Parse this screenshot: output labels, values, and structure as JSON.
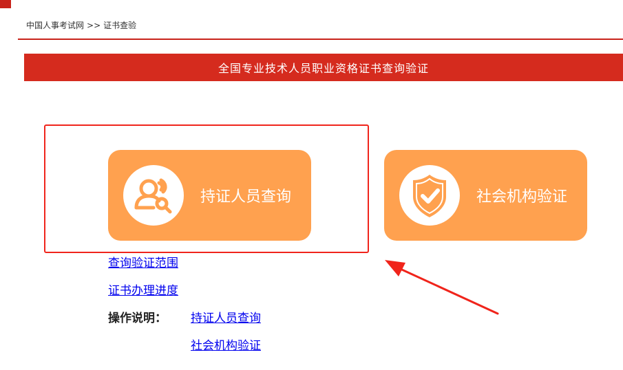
{
  "breadcrumb": {
    "home": "中国人事考试网",
    "separator": ">>",
    "current": "证书查验"
  },
  "banner": {
    "title": "全国专业技术人员职业资格证书查询验证"
  },
  "cards": [
    {
      "label": "持证人员查询",
      "icon": "person-search-icon"
    },
    {
      "label": "社会机构验证",
      "icon": "shield-check-icon"
    }
  ],
  "links": {
    "scope": "查询验证范围",
    "progress": "证书办理进度",
    "instructions_label": "操作说明：",
    "holder_query": "持证人员查询",
    "org_verify": "社会机构验证"
  },
  "colors": {
    "brand_red": "#d52b1e",
    "card_orange": "#ffa14f",
    "annotation_red": "#f0241b",
    "link_blue": "#0000ee"
  }
}
